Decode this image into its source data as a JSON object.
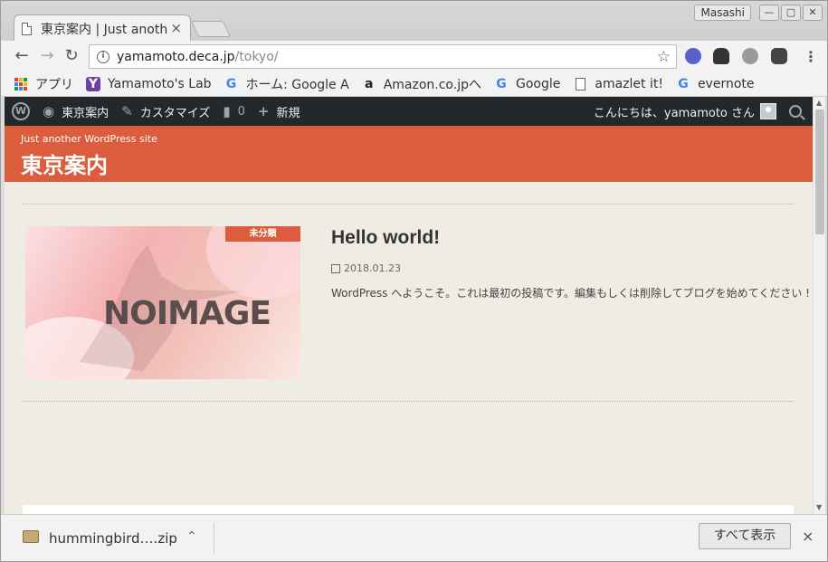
{
  "browser": {
    "tab_title": "東京案内 | Just another WordPress site",
    "tab_close": "×",
    "profile_name": "Masashi",
    "window_buttons": {
      "minimize": "—",
      "maximize": "▢",
      "close": "✕"
    },
    "url_host": "yamamoto.deca.jp",
    "url_path": "/tokyo/",
    "bookmarks": [
      {
        "label": "アプリ",
        "icon": "apps-grid-icon"
      },
      {
        "label": "Yamamoto's Lab",
        "icon": "y-icon"
      },
      {
        "label": "ホーム: Google A",
        "icon": "google-icon"
      },
      {
        "label": "Amazon.co.jpへ",
        "icon": "amazon-icon"
      },
      {
        "label": "Google",
        "icon": "google-icon"
      },
      {
        "label": "amazlet it!",
        "icon": "doc-icon"
      },
      {
        "label": "evernote",
        "icon": "google-icon"
      }
    ]
  },
  "admin_bar": {
    "site_name": "東京案内",
    "customize": "カスタマイズ",
    "comments_count": "0",
    "new_label": "新規",
    "greeting": "こんにちは、yamamoto さん"
  },
  "site": {
    "tagline": "Just another WordPress site",
    "title": "東京案内",
    "accent_color": "#dc5c3e"
  },
  "post": {
    "category": "未分類",
    "thumbnail_text": "NOIMAGE",
    "title": "Hello world!",
    "date": "2018.01.23",
    "excerpt": "WordPress へようこそ。これは最初の投稿です。編集もしくは削除してブログを始めてください !"
  },
  "download_shelf": {
    "filename": "hummingbird….zip",
    "show_all": "すべて表示",
    "close": "×"
  }
}
